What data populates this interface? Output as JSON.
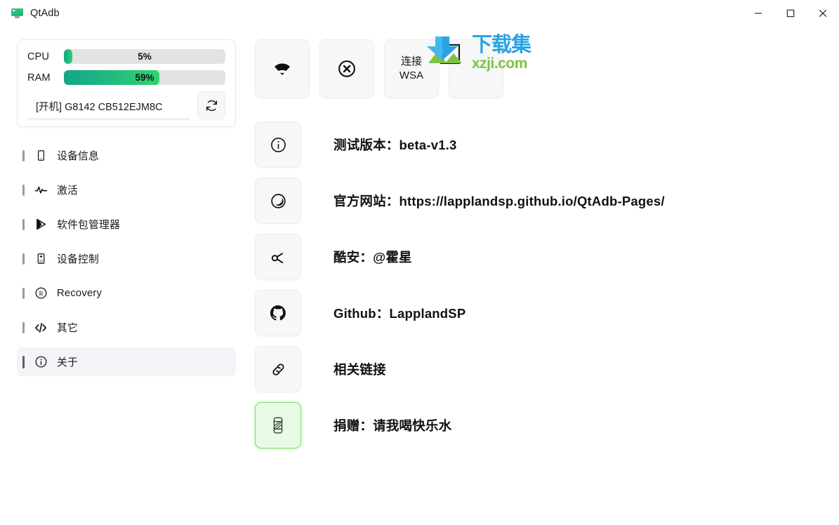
{
  "window": {
    "title": "QtAdb",
    "app_icon": "monitor-icon",
    "controls": {
      "minimize": "minimize-icon",
      "maximize": "maximize-icon",
      "close": "close-icon"
    }
  },
  "status_panel": {
    "meters": [
      {
        "label": "CPU",
        "value": 5,
        "display": "5%"
      },
      {
        "label": "RAM",
        "value": 59,
        "display": "59%"
      }
    ],
    "device": {
      "value": "[开机] G8142 CB512EJM8C",
      "refresh_icon": "refresh-icon"
    },
    "fill_gradient_start": "#13a58a",
    "fill_gradient_end": "#2fd271",
    "track_color": "#e3e3e3"
  },
  "sidebar": {
    "items": [
      {
        "label": "设备信息",
        "icon": "phone-icon",
        "active": false
      },
      {
        "label": "激活",
        "icon": "activity-pulse-icon",
        "active": false
      },
      {
        "label": "软件包管理器",
        "icon": "play-store-icon",
        "active": false
      },
      {
        "label": "设备控制",
        "icon": "remote-control-icon",
        "active": false
      },
      {
        "label": "Recovery",
        "icon": "registered-r-icon",
        "active": false
      },
      {
        "label": "其它",
        "icon": "code-brackets-icon",
        "active": false
      },
      {
        "label": "关于",
        "icon": "info-circle-icon",
        "active": true
      }
    ],
    "active_background": "#f2f4f8"
  },
  "toolbar": {
    "buttons": [
      {
        "id": "wifi",
        "icon": "wifi-icon",
        "label": ""
      },
      {
        "id": "disconnect",
        "icon": "close-circle-icon",
        "label": ""
      },
      {
        "id": "connect-wsa",
        "icon": "",
        "label_line1": "连接",
        "label_line2": "WSA"
      },
      {
        "id": "fourth",
        "icon": "",
        "label": ""
      }
    ]
  },
  "main": {
    "rows": [
      {
        "icon": "info-circle-icon",
        "text": "测试版本：beta-v1.3",
        "highlight": false
      },
      {
        "icon": "globe-icon",
        "text": "官方网站：https://lapplandsp.github.io/QtAdb-Pages/",
        "highlight": false
      },
      {
        "icon": "coolapk-icon",
        "text": "酷安：@霍星",
        "highlight": false
      },
      {
        "icon": "github-icon",
        "text": "Github：LapplandSP",
        "highlight": false
      },
      {
        "icon": "link-icon",
        "text": "相关链接",
        "highlight": false
      },
      {
        "icon": "soda-can-icon",
        "text": "捐赠：请我喝快乐水",
        "highlight": true
      }
    ],
    "highlight_background": "#e9fbe6",
    "highlight_border": "#7de26a"
  },
  "watermark": {
    "cn_text": "下载集",
    "url_text": "xzji.com",
    "cn_color": "#2aa3e0",
    "url_color": "#7fc242"
  }
}
